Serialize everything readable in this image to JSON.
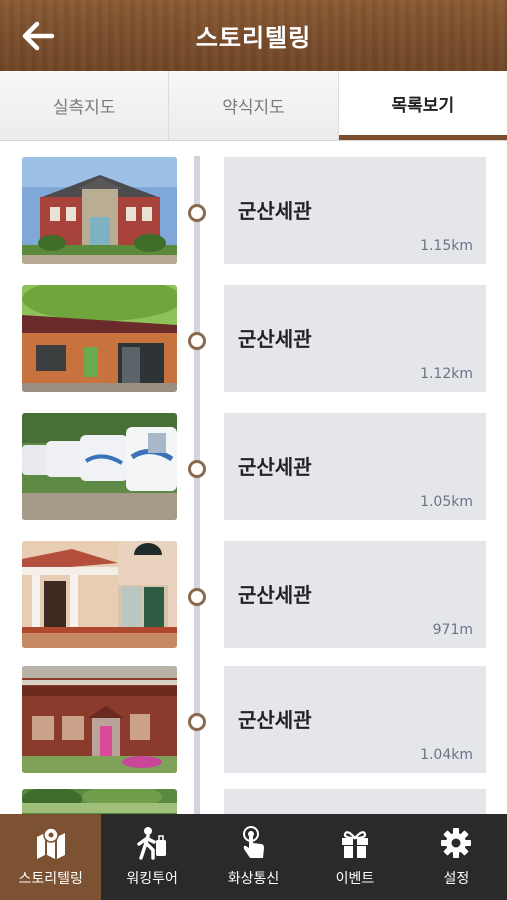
{
  "header": {
    "title": "스토리텔링",
    "back_icon": "arrow-left-icon"
  },
  "tabs": [
    {
      "label": "실측지도",
      "active": false
    },
    {
      "label": "약식지도",
      "active": false
    },
    {
      "label": "목록보기",
      "active": true
    }
  ],
  "list": [
    {
      "title": "군산세관",
      "distance": "1.15km",
      "thumb": "red-brick-customs-house"
    },
    {
      "title": "군산세관",
      "distance": "1.12km",
      "thumb": "wooden-cabin"
    },
    {
      "title": "군산세관",
      "distance": "1.05km",
      "thumb": "camping-trailers"
    },
    {
      "title": "군산세관",
      "distance": "971m",
      "thumb": "white-pillar-house"
    },
    {
      "title": "군산세관",
      "distance": "1.04km",
      "thumb": "red-wooden-lodge"
    },
    {
      "title": "",
      "distance": "",
      "thumb": "garden"
    }
  ],
  "bottom_nav": [
    {
      "label": "스토리텔링",
      "icon": "map-icon",
      "active": true
    },
    {
      "label": "워킹투어",
      "icon": "walking-tour-icon",
      "active": false
    },
    {
      "label": "화상통신",
      "icon": "touch-call-icon",
      "active": false
    },
    {
      "label": "이벤트",
      "icon": "gift-icon",
      "active": false
    },
    {
      "label": "설정",
      "icon": "gear-icon",
      "active": false
    }
  ],
  "colors": {
    "header": "#7a4e2c",
    "accent": "#7d5233",
    "card": "#e4e6ea",
    "nav": "#2a2a2a"
  }
}
